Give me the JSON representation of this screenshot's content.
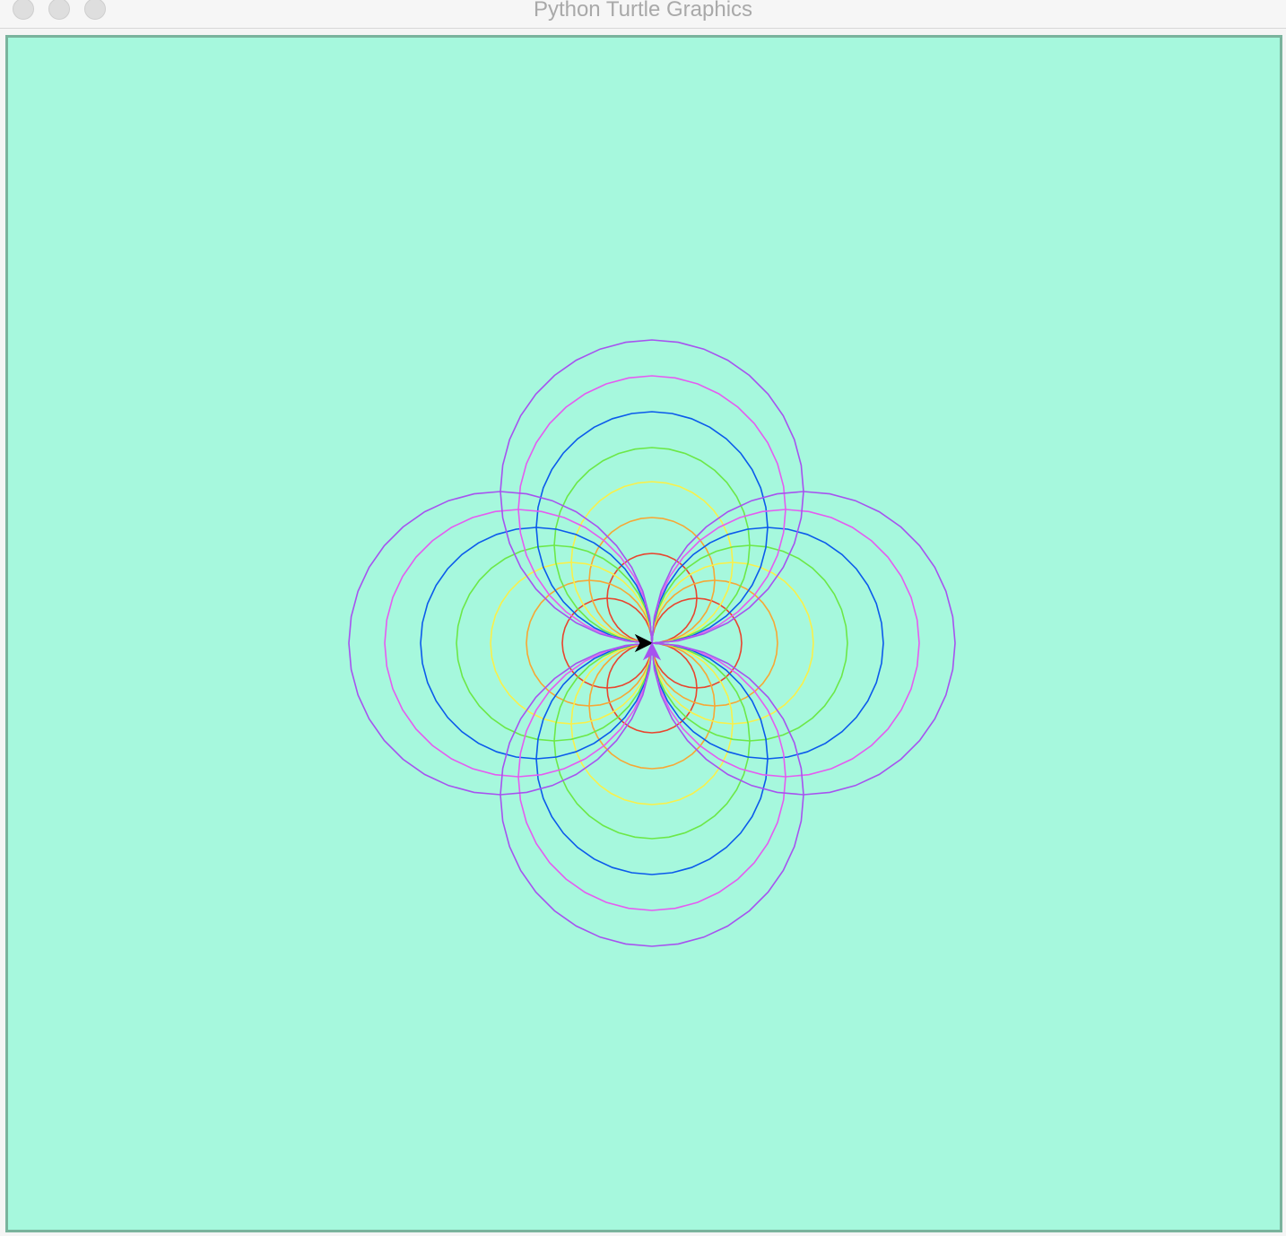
{
  "window": {
    "title": "Python Turtle Graphics"
  },
  "canvas": {
    "background": "#a6f8dd",
    "border_color": "#7ab39d"
  },
  "drawing": {
    "description_colors": [
      "#e8452e",
      "#f7a734",
      "#f9f04a",
      "#6ce848",
      "#0b5aeb",
      "#e45cf0",
      "#a653ef"
    ],
    "rings": [
      {
        "color": "#e8452e",
        "radius": 50
      },
      {
        "color": "#f7a734",
        "radius": 70
      },
      {
        "color": "#f9f04a",
        "radius": 90
      },
      {
        "color": "#6ce848",
        "radius": 109
      },
      {
        "color": "#0b5aeb",
        "radius": 129
      },
      {
        "color": "#e45cf0",
        "radius": 149
      },
      {
        "color": "#a653ef",
        "radius": 169
      }
    ],
    "polygon_sides": 36,
    "directions": [
      "up",
      "right",
      "down",
      "left"
    ],
    "turtle_cursors": [
      {
        "shape": "classic-arrow",
        "color": "#000000",
        "heading": "east"
      },
      {
        "shape": "classic-arrow",
        "color": "#a653ef",
        "heading": "north"
      }
    ]
  }
}
